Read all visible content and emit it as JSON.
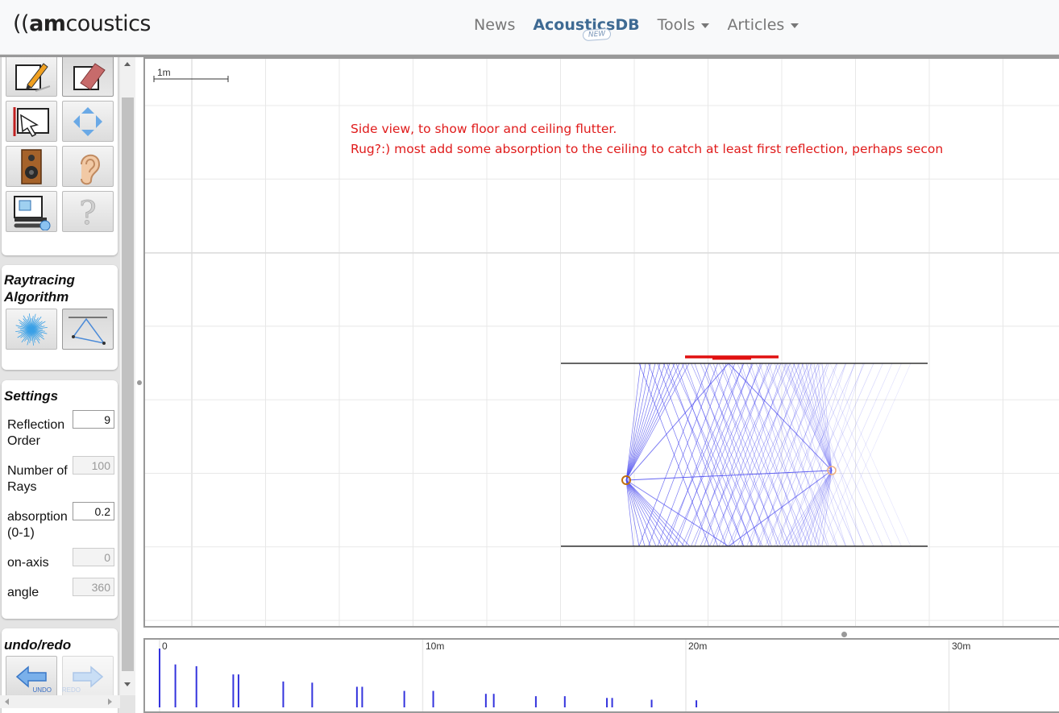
{
  "navbar": {
    "logo": {
      "prefix": "((",
      "mark": "am",
      "suffix": "coustics"
    },
    "links": [
      {
        "label": "News",
        "active": false,
        "dropdown": false
      },
      {
        "label": "AcousticsDB",
        "active": true,
        "dropdown": false,
        "badge": "NEW"
      },
      {
        "label": "Tools",
        "active": false,
        "dropdown": true
      },
      {
        "label": "Articles",
        "active": false,
        "dropdown": true
      }
    ]
  },
  "toolbar": {
    "tools": [
      {
        "name": "draw-wall-tool",
        "icon": "pencil-icon",
        "pressed": false
      },
      {
        "name": "eraser-tool",
        "icon": "eraser-icon",
        "pressed": true
      },
      {
        "name": "select-tool",
        "icon": "select-arrow-icon",
        "pressed": false
      },
      {
        "name": "move-tool",
        "icon": "move-arrows-icon",
        "pressed": false
      },
      {
        "name": "speaker-tool",
        "icon": "speaker-icon",
        "pressed": false
      },
      {
        "name": "listener-tool",
        "icon": "ear-icon",
        "pressed": false
      },
      {
        "name": "settings-tool",
        "icon": "monitor-wrench-icon",
        "pressed": false
      },
      {
        "name": "help-tool",
        "icon": "question-icon",
        "pressed": false
      }
    ]
  },
  "raytracing": {
    "title_line1": "Raytracing",
    "title_line2": "Algorithm",
    "options": [
      {
        "icon": "ray-burst-icon",
        "pressed": false
      },
      {
        "icon": "image-source-icon",
        "pressed": true
      }
    ]
  },
  "settings": {
    "title": "Settings",
    "fields": [
      {
        "label_line1": "Reflection",
        "label_line2": "Order",
        "value": "9",
        "enabled": true
      },
      {
        "label_line1": "Number of",
        "label_line2": "Rays",
        "value": "100",
        "enabled": false
      },
      {
        "label_line1": "absorption",
        "label_line2": "(0-1)",
        "value": "0.2",
        "enabled": true
      },
      {
        "label_line1": "on-axis",
        "label_line2": "",
        "value": "0",
        "enabled": false
      },
      {
        "label_line1": "angle",
        "label_line2": "",
        "value": "360",
        "enabled": false
      }
    ]
  },
  "undo_redo": {
    "title": "undo/redo",
    "undo_label": "UNDO",
    "redo_label": "REDO"
  },
  "canvas": {
    "scale_label": "1m",
    "annotation_line1": "Side view, to show floor and ceiling flutter.",
    "annotation_line2": "Rug?:) most add some absorption to the ceiling  to catch at least first reflection, perhaps secon",
    "colors": {
      "rays": "#4a4af0",
      "walls": "#333333",
      "absorber": "#e01010",
      "source": "#c07010",
      "listener": "#f0b080",
      "grid": "#e8e8e8"
    }
  },
  "echogram": {
    "axis_labels": [
      "0",
      "10m",
      "20m",
      "30m"
    ],
    "axis_values_m": [
      0,
      10,
      20,
      30
    ],
    "arrivals_m": [
      0.0,
      0.6,
      1.4,
      2.8,
      3.0,
      4.7,
      5.8,
      7.5,
      7.7,
      9.3,
      10.4,
      12.4,
      12.7,
      14.3,
      15.4,
      17.0,
      17.2,
      18.7,
      20.4
    ],
    "arrival_heights": [
      1.0,
      0.73,
      0.7,
      0.56,
      0.56,
      0.44,
      0.42,
      0.35,
      0.35,
      0.28,
      0.28,
      0.23,
      0.23,
      0.19,
      0.19,
      0.16,
      0.16,
      0.13,
      0.12
    ],
    "bar_color": "#3333dd"
  }
}
